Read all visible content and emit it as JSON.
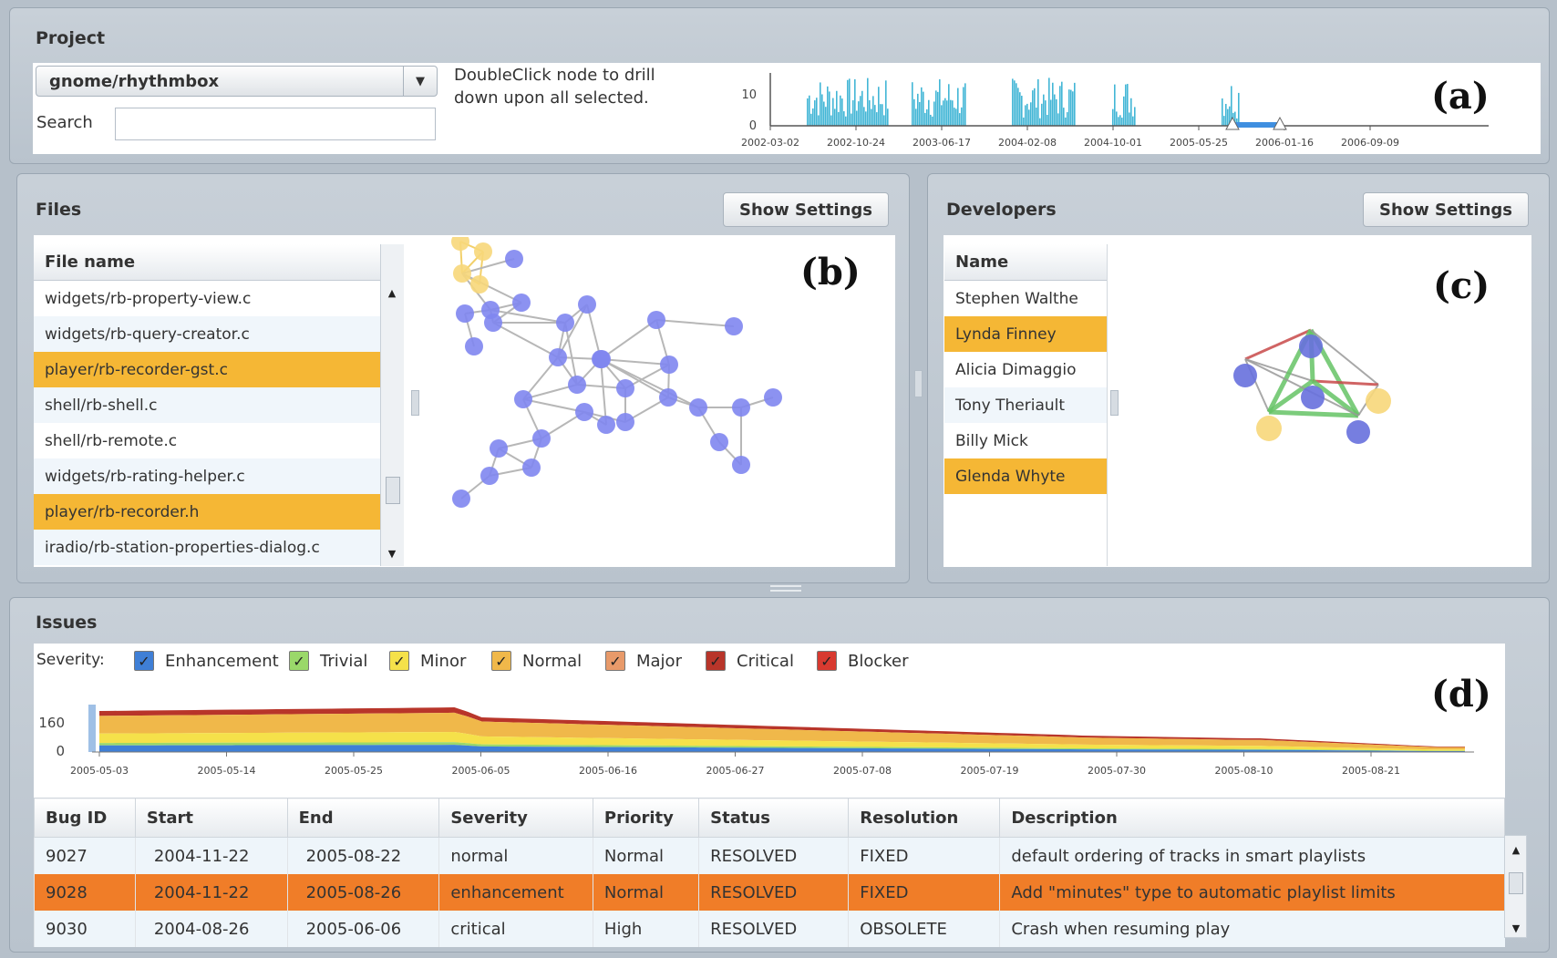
{
  "project": {
    "title": "Project",
    "selected": "gnome/rhythmbox",
    "search_label": "Search",
    "search_value": "",
    "hint": [
      "DoubleClick node to drill",
      "down upon all selected."
    ],
    "timeline": {
      "y_ticks": [
        "10",
        "0"
      ],
      "x_ticks": [
        "2002-03-02",
        "2002-10-24",
        "2003-06-17",
        "2004-02-08",
        "2004-10-01",
        "2005-05-25",
        "2006-01-16",
        "2006-09-09"
      ]
    },
    "panel_label": "(a)"
  },
  "files": {
    "title": "Files",
    "settings_label": "Show Settings",
    "column": "File name",
    "rows": [
      {
        "name": "widgets/rb-property-view.c",
        "selected": false
      },
      {
        "name": "widgets/rb-query-creator.c",
        "selected": false
      },
      {
        "name": "player/rb-recorder-gst.c",
        "selected": true
      },
      {
        "name": "shell/rb-shell.c",
        "selected": false
      },
      {
        "name": "shell/rb-remote.c",
        "selected": false
      },
      {
        "name": "widgets/rb-rating-helper.c",
        "selected": false
      },
      {
        "name": "player/rb-recorder.h",
        "selected": true
      },
      {
        "name": "iradio/rb-station-properties-dialog.c",
        "selected": false
      }
    ],
    "panel_label": "(b)"
  },
  "developers": {
    "title": "Developers",
    "settings_label": "Show Settings",
    "column": "Name",
    "rows": [
      {
        "name": "Stephen Walthe",
        "selected": false
      },
      {
        "name": "Lynda Finney",
        "selected": true
      },
      {
        "name": "Alicia Dimaggio",
        "selected": false
      },
      {
        "name": "Tony Theriault",
        "selected": false
      },
      {
        "name": "Billy Mick",
        "selected": false
      },
      {
        "name": "Glenda Whyte",
        "selected": true
      }
    ],
    "panel_label": "(c)"
  },
  "issues": {
    "title": "Issues",
    "severity_label": "Severity:",
    "severities": [
      {
        "label": "Enhancement",
        "color": "#3f7fd6",
        "checked": true
      },
      {
        "label": "Trivial",
        "color": "#9ad86a",
        "checked": true
      },
      {
        "label": "Minor",
        "color": "#f5e14a",
        "checked": true
      },
      {
        "label": "Normal",
        "color": "#f0b84a",
        "checked": true
      },
      {
        "label": "Major",
        "color": "#e89a6a",
        "checked": true
      },
      {
        "label": "Critical",
        "color": "#b8352a",
        "checked": true
      },
      {
        "label": "Blocker",
        "color": "#d83a30",
        "checked": true
      }
    ],
    "chart": {
      "y_ticks": [
        "160",
        "0"
      ],
      "x_ticks": [
        "2005-05-03",
        "2005-05-14",
        "2005-05-25",
        "2005-06-05",
        "2005-06-16",
        "2005-06-27",
        "2005-07-08",
        "2005-07-19",
        "2005-07-30",
        "2005-08-10",
        "2005-08-21"
      ]
    },
    "columns": [
      "Bug ID",
      "Start",
      "End",
      "Severity",
      "Priority",
      "Status",
      "Resolution",
      "Description"
    ],
    "rows": [
      {
        "cells": [
          "9027",
          "2004-11-22",
          "2005-08-22",
          "normal",
          "Normal",
          "RESOLVED",
          "FIXED",
          "default ordering of tracks in smart playlists"
        ],
        "highlight": false
      },
      {
        "cells": [
          "9028",
          "2004-11-22",
          "2005-08-26",
          "enhancement",
          "Normal",
          "RESOLVED",
          "FIXED",
          "Add \"minutes\" type to automatic playlist limits"
        ],
        "highlight": true
      },
      {
        "cells": [
          "9030",
          "2004-08-26",
          "2005-06-06",
          "critical",
          "High",
          "RESOLVED",
          "OBSOLETE",
          "Crash when resuming play"
        ],
        "highlight": false
      }
    ],
    "panel_label": "(d)"
  },
  "colors": {
    "node": "#7f86ef",
    "node_selected": "#f7d77a",
    "selection": "#f5b735",
    "row_highlight": "#f07d28"
  }
}
